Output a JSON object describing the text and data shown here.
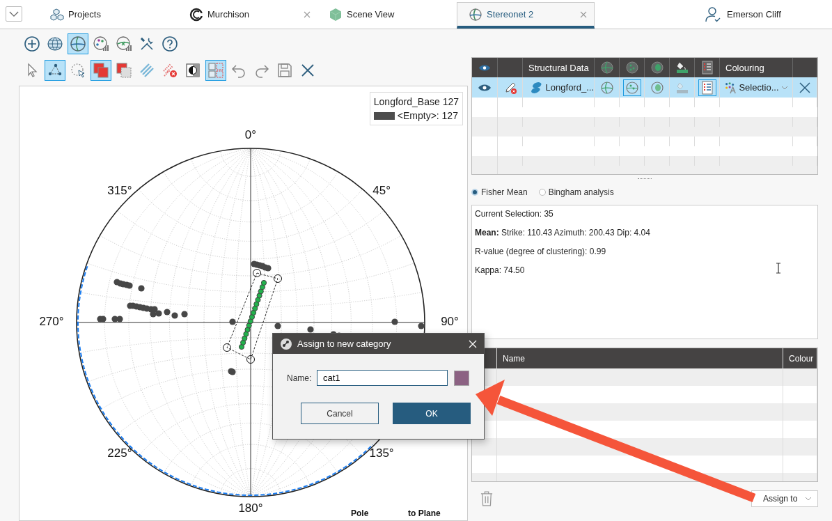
{
  "tabs": [
    {
      "label": "Projects",
      "kind": "projects",
      "selected": false,
      "close": false
    },
    {
      "label": "Murchison",
      "kind": "project",
      "selected": false,
      "close": true
    },
    {
      "label": "Scene View",
      "kind": "scene",
      "selected": false,
      "close": false
    },
    {
      "label": "Stereonet 2",
      "kind": "stereonet",
      "selected": true,
      "close": true
    }
  ],
  "user": {
    "name": "Emerson Cliff"
  },
  "toolbar_rows": [
    [
      {
        "kind": "add",
        "selected": false
      },
      {
        "kind": "globe",
        "selected": false
      },
      {
        "kind": "stereonet",
        "selected": true
      },
      {
        "kind": "palette",
        "selected": false
      },
      {
        "kind": "chartx",
        "selected": false
      },
      {
        "kind": "tools",
        "selected": false
      },
      {
        "kind": "help",
        "selected": false
      }
    ],
    [
      {
        "kind": "pointer",
        "selected": false
      },
      {
        "kind": "polygon",
        "selected": true
      },
      {
        "kind": "lasso",
        "selected": false
      },
      {
        "kind": "redsq",
        "selected": true
      },
      {
        "kind": "redsqdash",
        "selected": false
      },
      {
        "kind": "lines",
        "selected": false
      },
      {
        "kind": "linesx",
        "selected": false
      },
      {
        "kind": "contrast",
        "selected": false
      },
      {
        "kind": "grid",
        "selected": true
      },
      {
        "kind": "undo",
        "selected": false
      },
      {
        "kind": "redo",
        "selected": false
      },
      {
        "kind": "save",
        "selected": false
      },
      {
        "kind": "close",
        "selected": false
      }
    ]
  ],
  "plot": {
    "legend": {
      "title": "Longford_Base 127",
      "entries": [
        {
          "label": "<Empty>: 127",
          "color": "#4d4d4d"
        }
      ]
    },
    "direction_labels": [
      "0°",
      "45°",
      "90°",
      "135°",
      "180°",
      "225°",
      "270°",
      "315°"
    ],
    "footer": [
      "Pole",
      "to Plane"
    ]
  },
  "data_table": {
    "columns": [
      "Structural Data",
      "Colouring"
    ],
    "rows": [
      {
        "selected": true,
        "name": "Longford_...",
        "colouring": "Selectio...",
        "toggles": [
          {
            "on": false,
            "disabled": false
          },
          {
            "on": true,
            "disabled": false
          },
          {
            "on": false,
            "disabled": false
          },
          {
            "on": false,
            "disabled": true
          },
          {
            "on": true,
            "disabled": false
          }
        ]
      }
    ]
  },
  "analysis": {
    "options": [
      {
        "label": "Fisher Mean",
        "selected": true
      },
      {
        "label": "Bingham analysis",
        "selected": false
      }
    ],
    "results": [
      "Current Selection: 35",
      "**Mean:** Strike: 110.43 Azimuth: 200.43 Dip: 4.04",
      "R-value (degree of clustering): 0.99",
      "Kappa: 74.50"
    ]
  },
  "categories_table": {
    "columns": [
      "Name",
      "Colour"
    ]
  },
  "assign_button": {
    "label": "Assign to"
  },
  "dialog": {
    "title": "Assign to new category",
    "name_label": "Name:",
    "name_value": "cat1",
    "color": "#8c6283",
    "buttons": [
      {
        "label": "Cancel",
        "kind": "secondary"
      },
      {
        "label": "OK",
        "kind": "primary"
      }
    ]
  }
}
